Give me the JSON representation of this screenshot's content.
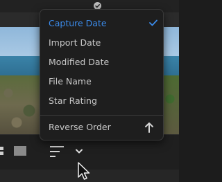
{
  "sort_menu": {
    "items": [
      {
        "label": "Capture Date",
        "selected": true
      },
      {
        "label": "Import Date",
        "selected": false
      },
      {
        "label": "Modified Date",
        "selected": false
      },
      {
        "label": "File Name",
        "selected": false
      },
      {
        "label": "Star Rating",
        "selected": false
      }
    ],
    "reverse_order_label": "Reverse Order"
  },
  "icons": {
    "top_badge": "checkmark-badge-icon",
    "grid_view": "grid-view-icon",
    "single_view": "single-view-icon",
    "sort": "sort-lines-icon",
    "sort_dropdown": "chevron-down-icon",
    "reverse": "arrow-up-icon",
    "selected_check": "checkmark-icon",
    "cursor": "mouse-pointer-icon"
  },
  "colors": {
    "accent": "#3b8bea",
    "menu_background": "#1e1e1e",
    "menu_text": "#c9c9c9",
    "toolbar_background": "#1f1f1f"
  }
}
